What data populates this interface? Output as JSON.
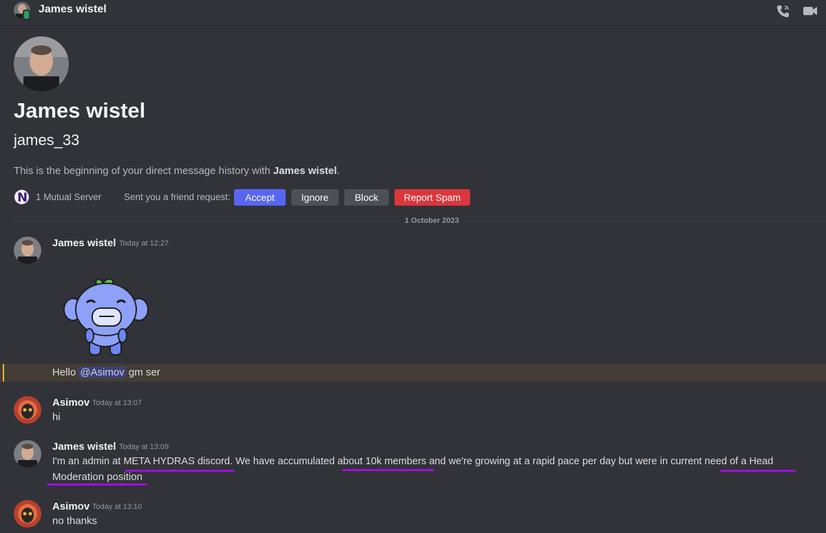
{
  "header": {
    "title": "James wistel"
  },
  "intro": {
    "display_name": "James wistel",
    "username": "james_33",
    "description_prefix": "This is the beginning of your direct message history with ",
    "description_name": "James wistel",
    "description_suffix": ".",
    "mutual_servers": "1 Mutual Server",
    "friend_request_text": "Sent you a friend request:",
    "server_initial": "N",
    "buttons": {
      "accept": "Accept",
      "ignore": "Ignore",
      "block": "Block",
      "report": "Report Spam"
    }
  },
  "divider": {
    "date": "1 October 2023"
  },
  "messages": [
    {
      "author": "James wistel",
      "timestamp": "Today at 12:27",
      "text_prefix": "Hello ",
      "mention": "@Asimov",
      "text_suffix": " gm ser"
    },
    {
      "author": "Asimov",
      "timestamp": "Today at 13:07",
      "text": "hi"
    },
    {
      "author": "James wistel",
      "timestamp": "Today at 13:09",
      "line1": "I'm an admin at META HYDRAS discord. We have accumulated about 10k members and we're growing at a rapid pace per day but were in current need of a Head",
      "line2": "Moderation position"
    },
    {
      "author": "Asimov",
      "timestamp": "Today at 13:10",
      "text": "no thanks"
    }
  ],
  "colors": {
    "background": "#313338",
    "accept": "#5865f2",
    "report": "#da373c",
    "mention_highlight": "#433d36",
    "annotation_underline": "#a10ee0"
  }
}
